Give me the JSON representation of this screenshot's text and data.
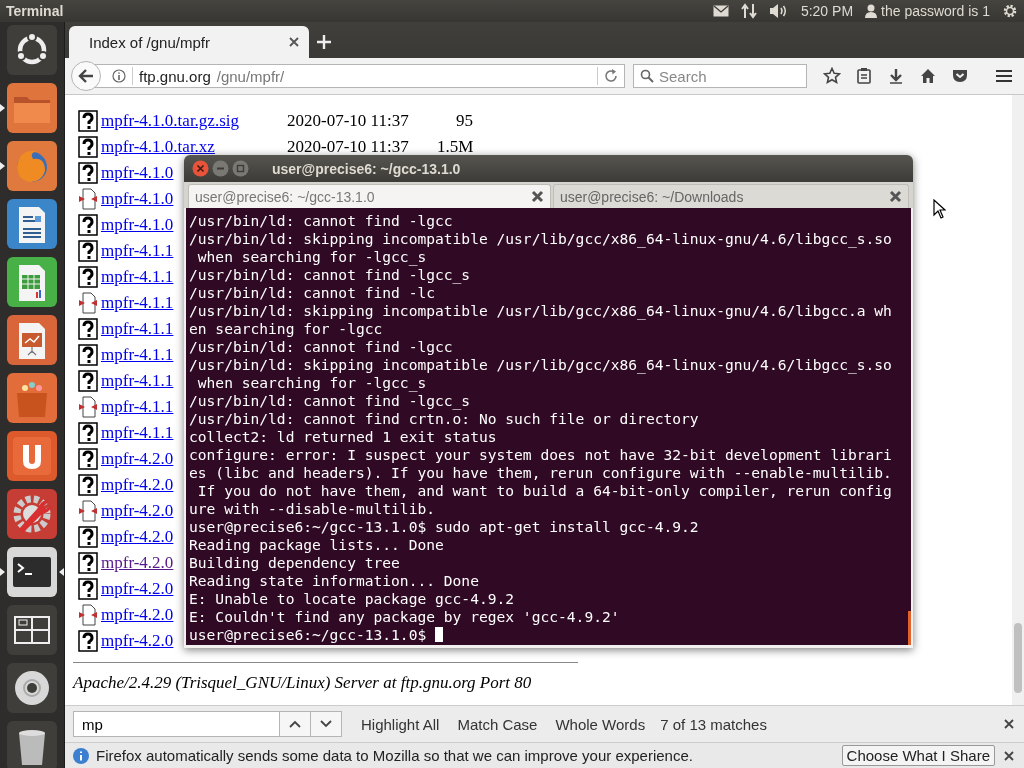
{
  "top_panel": {
    "app_title": "Terminal",
    "clock": "5:20 PM",
    "user": "the password is 1"
  },
  "launcher": [
    {
      "kind": "home",
      "running": false,
      "focused": false
    },
    {
      "kind": "files",
      "running": true,
      "focused": false
    },
    {
      "kind": "browser",
      "running": true,
      "focused": false
    },
    {
      "kind": "writer",
      "running": false,
      "focused": false
    },
    {
      "kind": "spreadsheet",
      "running": false,
      "focused": false
    },
    {
      "kind": "presentation",
      "running": false,
      "focused": false
    },
    {
      "kind": "software",
      "running": false,
      "focused": false
    },
    {
      "kind": "cloud",
      "running": false,
      "focused": false
    },
    {
      "kind": "settings",
      "running": false,
      "focused": false
    },
    {
      "kind": "terminal",
      "running": true,
      "focused": true
    },
    {
      "kind": "workspaces",
      "running": false,
      "focused": false
    },
    {
      "kind": "disc",
      "running": false,
      "focused": false
    },
    {
      "kind": "trash",
      "running": false,
      "focused": false
    }
  ],
  "browser": {
    "tabs": [
      {
        "title": "Index of /gnu/mpfr",
        "selected": true
      }
    ],
    "url_host": "ftp.gnu.org",
    "url_path": "/gnu/mpfr/",
    "search": {
      "placeholder": "Search"
    },
    "files": [
      {
        "name": "mpfr-4.1.0.tar.gz.sig",
        "kind": "unknown",
        "visited": false,
        "date": "2020-07-10 11:37",
        "size": "95"
      },
      {
        "name": "mpfr-4.1.0.tar.xz",
        "kind": "unknown",
        "visited": false,
        "date": "2020-07-10 11:37",
        "size": "1.5M"
      },
      {
        "name": "mpfr-4.1.0",
        "kind": "unknown",
        "visited": false
      },
      {
        "name": "mpfr-4.1.0",
        "kind": "archive",
        "visited": false
      },
      {
        "name": "mpfr-4.1.0",
        "kind": "unknown",
        "visited": false
      },
      {
        "name": "mpfr-4.1.1",
        "kind": "unknown",
        "visited": false
      },
      {
        "name": "mpfr-4.1.1",
        "kind": "unknown",
        "visited": false
      },
      {
        "name": "mpfr-4.1.1",
        "kind": "archive",
        "visited": false
      },
      {
        "name": "mpfr-4.1.1",
        "kind": "unknown",
        "visited": false
      },
      {
        "name": "mpfr-4.1.1",
        "kind": "unknown",
        "visited": false
      },
      {
        "name": "mpfr-4.1.1",
        "kind": "unknown",
        "visited": false
      },
      {
        "name": "mpfr-4.1.1",
        "kind": "archive",
        "visited": false
      },
      {
        "name": "mpfr-4.1.1",
        "kind": "unknown",
        "visited": false
      },
      {
        "name": "mpfr-4.2.0",
        "kind": "unknown",
        "visited": false
      },
      {
        "name": "mpfr-4.2.0",
        "kind": "unknown",
        "visited": false
      },
      {
        "name": "mpfr-4.2.0",
        "kind": "archive",
        "visited": false
      },
      {
        "name": "mpfr-4.2.0",
        "kind": "unknown",
        "visited": false
      },
      {
        "name": "mpfr-4.2.0",
        "kind": "unknown",
        "visited": true
      },
      {
        "name": "mpfr-4.2.0",
        "kind": "unknown",
        "visited": false
      },
      {
        "name": "mpfr-4.2.0",
        "kind": "archive",
        "visited": false
      },
      {
        "name": "mpfr-4.2.0",
        "kind": "unknown",
        "visited": false
      }
    ],
    "server_signature": "Apache/2.4.29 (Trisquel_GNU/Linux) Server at ftp.gnu.org Port 80",
    "find_bar": {
      "value": "mp",
      "options": [
        "Highlight All",
        "Match Case",
        "Whole Words"
      ],
      "status": "7 of 13 matches"
    },
    "notification": {
      "text": "Firefox automatically sends some data to Mozilla so that we can improve your experience.",
      "button": "Choose What I Share"
    }
  },
  "terminal": {
    "title": "user@precise6: ~/gcc-13.1.0",
    "tabs": [
      {
        "label": "user@precise6: ~/gcc-13.1.0",
        "selected": true
      },
      {
        "label": "user@precise6: ~/Downloads",
        "selected": false
      }
    ],
    "lines": [
      "/usr/bin/ld: cannot find -lgcc",
      "/usr/bin/ld: skipping incompatible /usr/lib/gcc/x86_64-linux-gnu/4.6/libgcc_s.so",
      " when searching for -lgcc_s",
      "/usr/bin/ld: cannot find -lgcc_s",
      "/usr/bin/ld: cannot find -lc",
      "/usr/bin/ld: skipping incompatible /usr/lib/gcc/x86_64-linux-gnu/4.6/libgcc.a wh",
      "en searching for -lgcc",
      "/usr/bin/ld: cannot find -lgcc",
      "/usr/bin/ld: skipping incompatible /usr/lib/gcc/x86_64-linux-gnu/4.6/libgcc_s.so",
      " when searching for -lgcc_s",
      "/usr/bin/ld: cannot find -lgcc_s",
      "/usr/bin/ld: cannot find crtn.o: No such file or directory",
      "collect2: ld returned 1 exit status",
      "configure: error: I suspect your system does not have 32-bit development librari",
      "es (libc and headers). If you have them, rerun configure with --enable-multilib.",
      " If you do not have them, and want to build a 64-bit-only compiler, rerun config",
      "ure with --disable-multilib.",
      "user@precise6:~/gcc-13.1.0$ sudo apt-get install gcc-4.9.2",
      "Reading package lists... Done",
      "Building dependency tree",
      "Reading state information... Done",
      "E: Unable to locate package gcc-4.9.2",
      "E: Couldn't find any package by regex 'gcc-4.9.2'",
      "user@precise6:~/gcc-13.1.0$ "
    ]
  }
}
